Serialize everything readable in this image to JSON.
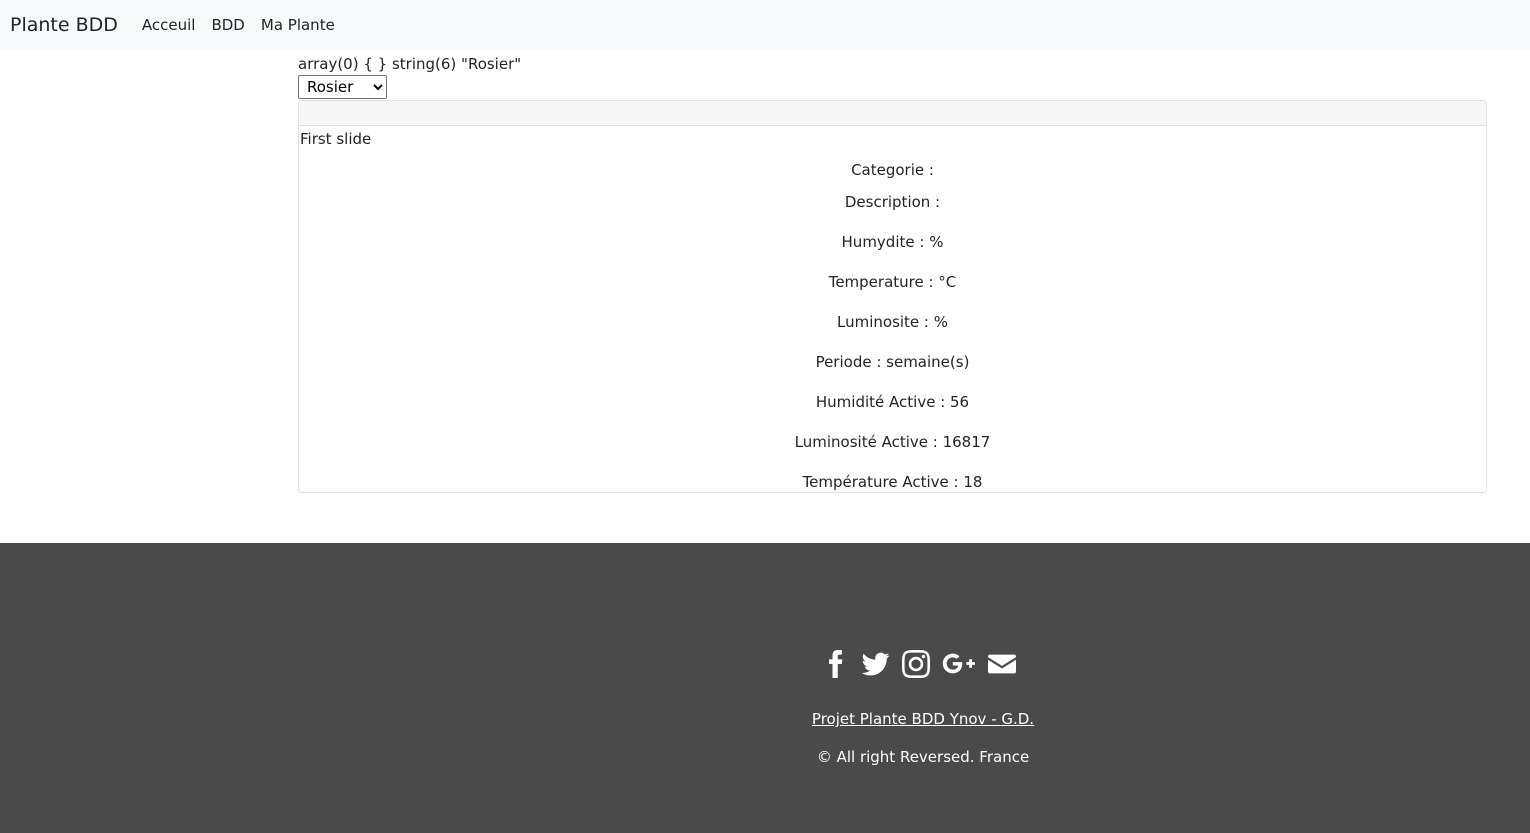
{
  "navbar": {
    "brand": "Plante BDD",
    "links": [
      "Acceuil",
      "BDD",
      "Ma Plante"
    ]
  },
  "debug_output": "array(0) { } string(6) \"Rosier\"",
  "plant_select": {
    "selected": "Rosier"
  },
  "slide": {
    "title": "First slide",
    "lines": [
      "Categorie :",
      "Description :",
      "Humydite : %",
      "Temperature : °C",
      "Luminosite : %",
      "Periode : semaine(s)",
      "Humidité Active : 56",
      "Luminosité Active : 16817",
      "Température Active : 18"
    ]
  },
  "footer": {
    "social_icons": [
      "facebook-icon",
      "twitter-icon",
      "instagram-icon",
      "google-plus-icon",
      "envelope-icon"
    ],
    "link_text": "Projet Plante BDD Ynov - G.D.",
    "copyright": "© All right Reversed.  France"
  },
  "colors": {
    "navbar_bg": "#f8f9fa",
    "footer_bg": "#4a4a4a"
  }
}
